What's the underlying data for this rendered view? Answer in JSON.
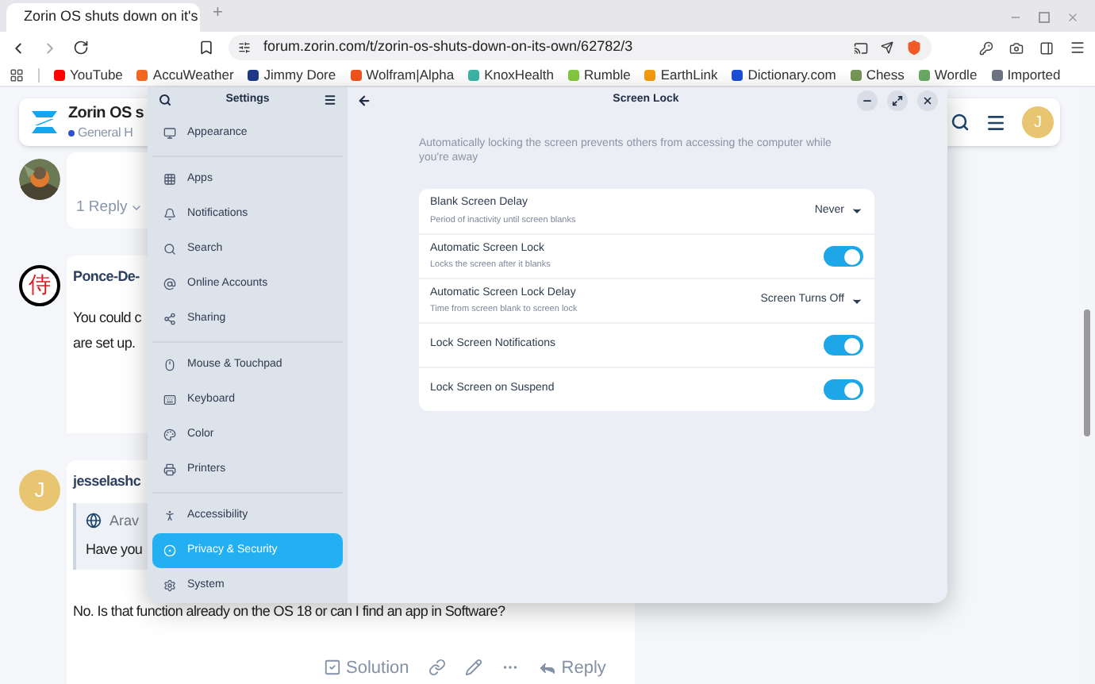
{
  "browser": {
    "tab": {
      "title": "Zorin OS shuts down on it's",
      "selected": true
    },
    "new_tab": "+",
    "url": "forum.zorin.com/t/zorin-os-shuts-down-on-its-own/62782/3",
    "bookmarks": [
      {
        "label": "YouTube",
        "color": "#ff0000"
      },
      {
        "label": "AccuWeather",
        "color": "#f26722"
      },
      {
        "label": "Jimmy Dore",
        "color": "#1e3a8a"
      },
      {
        "label": "Wolfram|Alpha",
        "color": "#f0541e"
      },
      {
        "label": "KnoxHealth",
        "color": "#3cb4a4"
      },
      {
        "label": "Rumble",
        "color": "#85c742"
      },
      {
        "label": "EarthLink",
        "color": "#f39c12"
      },
      {
        "label": "Dictionary.com",
        "color": "#1d4ed8"
      },
      {
        "label": "Chess",
        "color": "#769656"
      },
      {
        "label": "Wordle",
        "color": "#6aaa64"
      },
      {
        "label": "Imported",
        "color": "#6b7280"
      }
    ]
  },
  "forum": {
    "header": {
      "title": "Zorin OS s",
      "category": "General H",
      "avatar": "J"
    },
    "posts": [
      {
        "kind": "replies",
        "replies": "1 Reply"
      },
      {
        "kind": "post",
        "avatar": "侍",
        "author": "Ponce-De-",
        "lines": [
          "You could c",
          "are set up."
        ]
      },
      {
        "kind": "post",
        "avatar": "J",
        "author": "jesselashc",
        "quote": {
          "author": "Arav",
          "text": "Have you"
        },
        "lines": [
          "No. Is that function already on the OS 18 or can I find an app in Software?"
        ],
        "actions": {
          "solution": "Solution",
          "reply": "Reply"
        }
      }
    ]
  },
  "settings": {
    "title": "Settings",
    "groups": [
      {
        "items": [
          {
            "label": "Appearance",
            "selected": false
          }
        ]
      },
      {
        "items": [
          {
            "label": "Apps",
            "selected": false
          },
          {
            "label": "Notifications",
            "selected": false
          },
          {
            "label": "Search",
            "selected": false
          },
          {
            "label": "Online Accounts",
            "selected": false
          },
          {
            "label": "Sharing",
            "selected": false
          }
        ]
      },
      {
        "items": [
          {
            "label": "Mouse & Touchpad",
            "selected": false
          },
          {
            "label": "Keyboard",
            "selected": false
          },
          {
            "label": "Color",
            "selected": false
          },
          {
            "label": "Printers",
            "selected": false
          }
        ]
      },
      {
        "items": [
          {
            "label": "Accessibility",
            "selected": false
          },
          {
            "label": "Privacy & Security",
            "selected": true
          },
          {
            "label": "System",
            "selected": false
          }
        ]
      }
    ],
    "page": {
      "title": "Screen Lock",
      "description": "Automatically locking the screen prevents others from accessing the computer while you're away",
      "rows": [
        {
          "kind": "dropdown",
          "label": "Blank Screen Delay",
          "subtitle": "Period of inactivity until screen blanks",
          "value": "Never"
        },
        {
          "kind": "switch",
          "label": "Automatic Screen Lock",
          "subtitle": "Locks the screen after it blanks",
          "on": true
        },
        {
          "kind": "dropdown",
          "label": "Automatic Screen Lock Delay",
          "subtitle": "Time from screen blank to screen lock",
          "value": "Screen Turns Off"
        },
        {
          "kind": "switch",
          "label": "Lock Screen Notifications",
          "on": true
        },
        {
          "kind": "switch",
          "label": "Lock Screen on Suspend",
          "on": true
        }
      ]
    }
  }
}
